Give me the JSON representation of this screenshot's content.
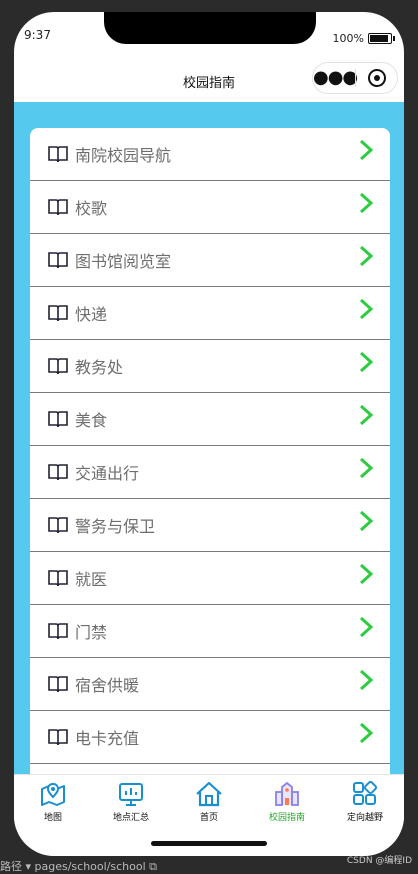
{
  "status": {
    "time": "9:37",
    "battery": "100%"
  },
  "nav": {
    "title": "校园指南"
  },
  "list": [
    {
      "label": "南院校园导航"
    },
    {
      "label": "校歌"
    },
    {
      "label": "图书馆阅览室"
    },
    {
      "label": "快递"
    },
    {
      "label": "教务处"
    },
    {
      "label": "美食"
    },
    {
      "label": "交通出行"
    },
    {
      "label": "警务与保卫"
    },
    {
      "label": "就医"
    },
    {
      "label": "门禁"
    },
    {
      "label": "宿舍供暖"
    },
    {
      "label": "电卡充值"
    },
    {
      "label": ""
    }
  ],
  "tabs": [
    {
      "label": "地图",
      "icon": "map-pin-icon"
    },
    {
      "label": "地点汇总",
      "icon": "chart-monitor-icon"
    },
    {
      "label": "首页",
      "icon": "home-icon"
    },
    {
      "label": "校园指南",
      "icon": "school-building-icon",
      "active": true
    },
    {
      "label": "定向越野",
      "icon": "grid-icon"
    }
  ],
  "bottom": {
    "path": "路径 ▾  pages/school/school ⧉",
    "watermark": "CSDN @编程ID"
  },
  "colors": {
    "accent": "#56c9ee",
    "chevron": "#2ecc40",
    "active_tab": "#2aa52a",
    "icon_blue": "#1a8fd0"
  }
}
